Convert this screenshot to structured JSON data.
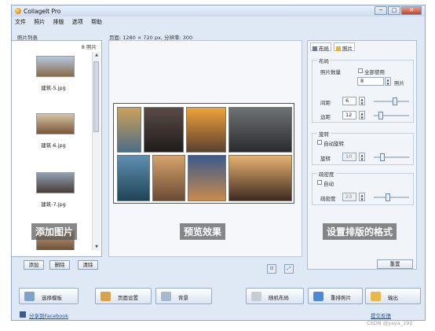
{
  "window": {
    "title": "CollageIt Pro",
    "controls": {
      "minimize": "─",
      "maximize": "□",
      "close": "✕"
    }
  },
  "menu": [
    "文件",
    "照片",
    "排版",
    "选项",
    "帮助"
  ],
  "photo_list": {
    "label": "照片列表",
    "count": "8 照片",
    "items": [
      {
        "name": "建筑-5.jpg",
        "colors": [
          "#b5c7de",
          "#8a6a4a"
        ]
      },
      {
        "name": "建筑-6.jpg",
        "colors": [
          "#d7c5a5",
          "#7a5636"
        ]
      },
      {
        "name": "建筑-7.jpg",
        "colors": [
          "#8fa1b3",
          "#4c3d35"
        ]
      },
      {
        "name": "",
        "colors": [
          "#c5a071",
          "#6a4c3a"
        ]
      }
    ],
    "buttons": {
      "add": "添加",
      "delete": "删除",
      "clear": "清除"
    },
    "overlay": "添加图片"
  },
  "preview": {
    "info": "页面: 1280 × 720 px, 分辨率: 300",
    "overlay": "预览效果",
    "cells": [
      {
        "colors": [
          "#caa15a",
          "#4d6d85"
        ]
      },
      {
        "colors": [
          "#5b4b46",
          "#1f1c1b"
        ]
      },
      {
        "colors": [
          "#f0a23a",
          "#5a4030"
        ]
      },
      {
        "colors": [
          "#6f7274",
          "#2a2b2e"
        ]
      },
      {
        "colors": [
          "#5f8fb0",
          "#204457"
        ]
      },
      {
        "colors": [
          "#d6a46b",
          "#6b4a34"
        ]
      },
      {
        "colors": [
          "#3c5b8c",
          "#c98a4c"
        ]
      },
      {
        "colors": [
          "#e8b271",
          "#3e2a22"
        ]
      }
    ]
  },
  "settings": {
    "tabs": {
      "layout": "布局",
      "photo": "照片"
    },
    "layout_group": {
      "title": "布局",
      "photo_count_label": "照片数量",
      "use_all_label": "全部使用",
      "photo_count_value": "8",
      "photo_unit": "照片",
      "spacing_label": "间距",
      "spacing_value": "6",
      "margin_label": "边距",
      "margin_value": "12"
    },
    "rotation_group": {
      "title": "旋转",
      "auto_label": "自动旋转",
      "rotate_label": "旋转",
      "rotate_value": "10"
    },
    "sparsity_group": {
      "title": "疏密度",
      "auto_label": "自动",
      "sparsity_label": "疏密度",
      "sparsity_value": "23"
    },
    "overlay": "设置排版的格式",
    "reset": "重置"
  },
  "bottom_buttons": {
    "template": "选择模板",
    "page_setup": "页面设置",
    "background": "背景",
    "random_layout": "随机布局",
    "rearrange": "重排照片",
    "output": "输出"
  },
  "footer": {
    "share": "分享到Facebook",
    "feedback": "提交反馈",
    "watermark": "CSDN @yaya_192"
  }
}
